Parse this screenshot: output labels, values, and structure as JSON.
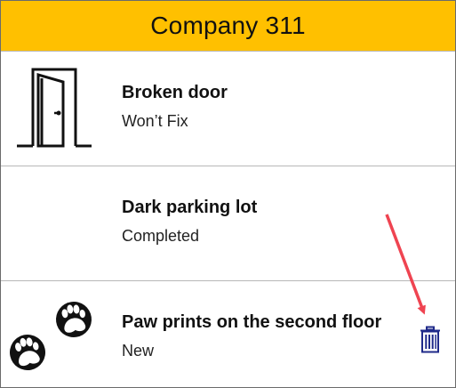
{
  "header": {
    "title": "Company 311",
    "color": "#ffc000"
  },
  "items": [
    {
      "title": "Broken door",
      "status": "Won’t Fix",
      "icon": "door-icon"
    },
    {
      "title": "Dark parking lot",
      "status": "Completed",
      "icon": ""
    },
    {
      "title": "Paw prints on the second floor",
      "status": "New",
      "icon": "paw-prints-icon"
    }
  ],
  "delete_icon": "trash-icon",
  "accent": {
    "trash_color": "#1f2a8a",
    "arrow_color": "#ef4451"
  }
}
